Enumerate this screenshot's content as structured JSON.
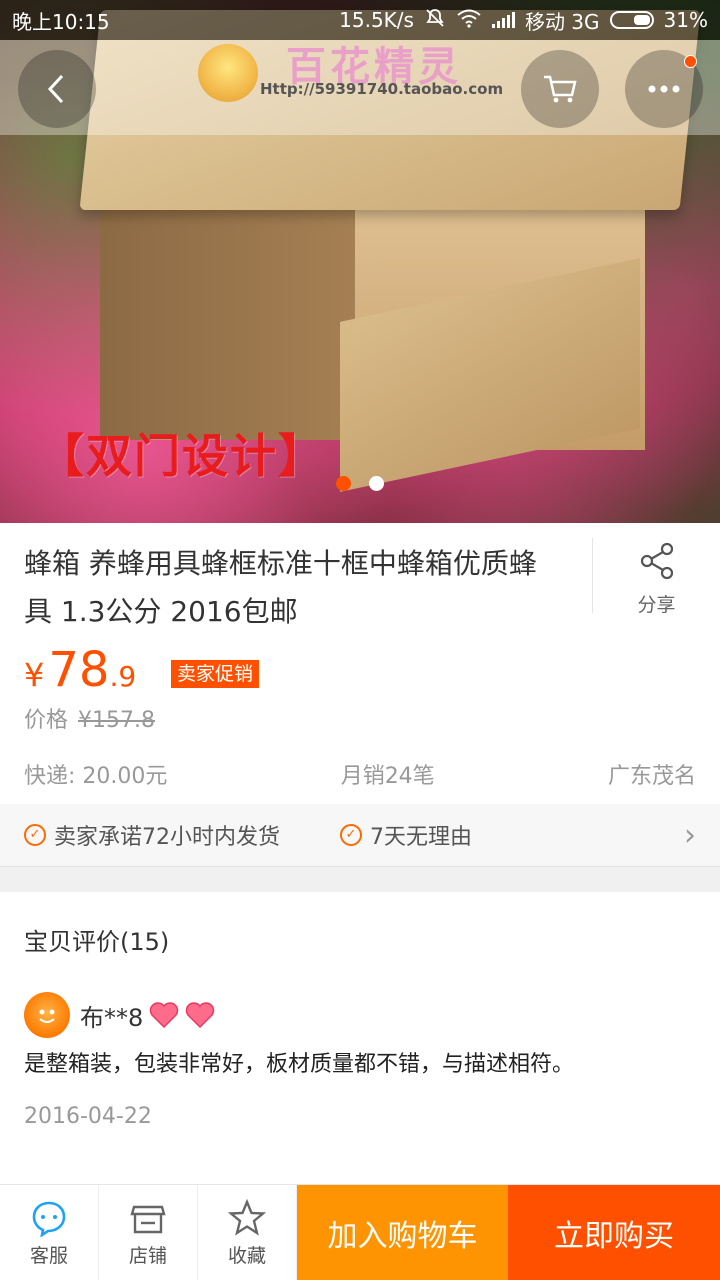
{
  "status_bar": {
    "time": "晚上10:15",
    "net_speed": "15.5K/s",
    "carrier": "移动 3G",
    "battery": "31%"
  },
  "hero": {
    "watermark_title": "百花精灵",
    "watermark_url": "Http://59391740.taobao.com",
    "promo_label": "【双门设计】",
    "slide_count": 2,
    "active_slide": 1
  },
  "nav": {
    "back_icon": "chevron-left-icon",
    "cart_icon": "cart-icon",
    "more_icon": "more-icon"
  },
  "product": {
    "title": "蜂箱 养蜂用具蜂框标准十框中蜂箱优质蜂具 1.3公分 2016包邮",
    "share_label": "分享",
    "price_symbol": "¥",
    "price_integer": "78",
    "price_decimal": ".9",
    "promo_badge": "卖家促销",
    "original_price_label": "价格",
    "original_price": "¥157.8",
    "shipping": "快递: 20.00元",
    "monthly_sales": "月销24笔",
    "location": "广东茂名"
  },
  "guarantees": [
    {
      "label": "卖家承诺72小时内发货"
    },
    {
      "label": "7天无理由"
    }
  ],
  "reviews": {
    "title": "宝贝评价(15)",
    "items": [
      {
        "user": "布**8",
        "text": "是整箱装，包装非常好，板材质量都不错，与描述相符。",
        "date": "2016-04-22"
      }
    ]
  },
  "bottom_bar": {
    "service_label": "客服",
    "shop_label": "店铺",
    "favorite_label": "收藏",
    "add_cart_label": "加入购物车",
    "buy_now_label": "立即购买"
  },
  "colors": {
    "accent": "#ff5000",
    "cart_button": "#ff9402",
    "service_icon": "#1fa2f5"
  }
}
